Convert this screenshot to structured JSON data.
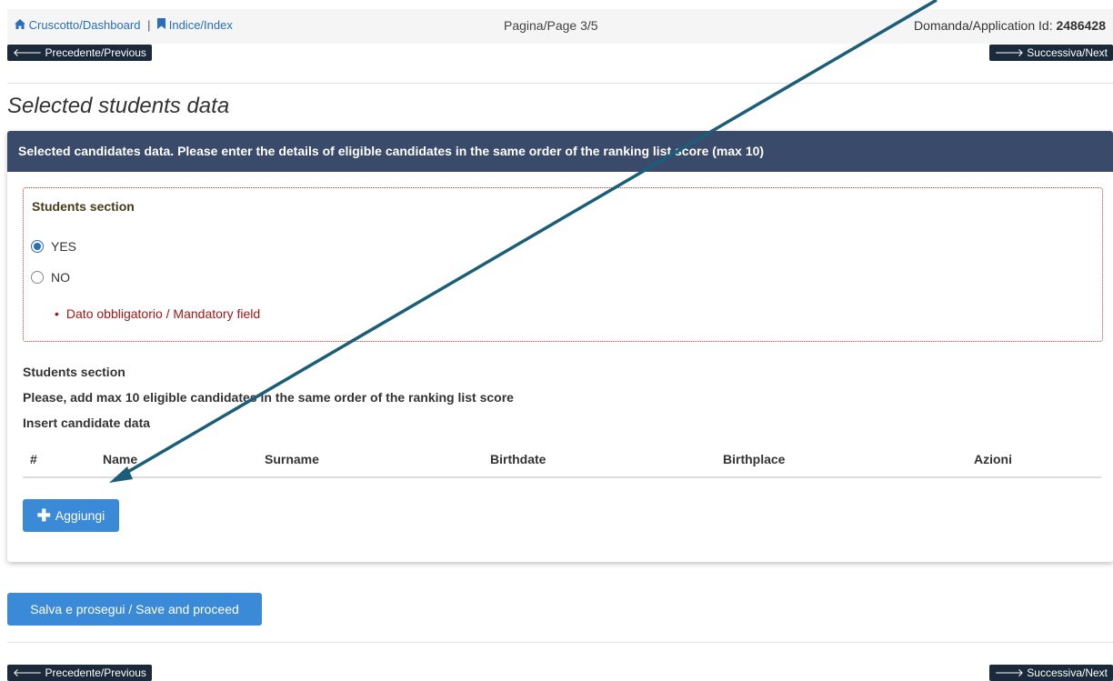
{
  "topbar": {
    "dashboard_link": "Cruscotto/Dashboard",
    "separator": "|",
    "index_link": "Indice/Index",
    "page_indicator": "Pagina/Page 3/5",
    "application_label": "Domanda/Application Id:",
    "application_id": "2486428"
  },
  "nav": {
    "previous_label": "Precedente/Previous",
    "next_label": "Successiva/Next"
  },
  "page": {
    "title": "Selected students data"
  },
  "panel": {
    "header": "Selected candidates data. Please enter the details of eligible candidates in the same order of the ranking list score (max 10)",
    "error_box": {
      "section_title": "Students section",
      "options": [
        "YES",
        "NO"
      ],
      "selected": "YES",
      "error_message": "Dato obbligatorio / Mandatory field"
    },
    "students_section": "Students section",
    "instructions": "Please, add max 10 eligible candidates in the same order of the ranking list score",
    "insert_label": "Insert candidate data",
    "table_headers": [
      "#",
      "Name",
      "Surname",
      "Birthdate",
      "Birthplace",
      "Azioni"
    ],
    "add_button": "Aggiungi"
  },
  "save_button": "Salva e prosegui / Save and proceed",
  "colors": {
    "panel_header": "#3a4a6b",
    "nav_button": "#1b2a3b",
    "primary_button": "#3a8ad8",
    "error": "#a01818",
    "annotation_arrow": "#1b5e7a"
  },
  "icons": {
    "dashboard": "home-icon",
    "index": "bookmark-icon",
    "previous": "arrow-left-icon",
    "next": "arrow-right-icon",
    "add": "plus-icon"
  }
}
